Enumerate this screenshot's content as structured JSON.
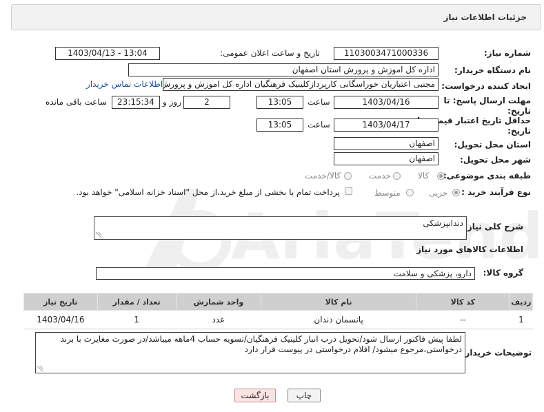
{
  "header": {
    "title": "جزئیات اطلاعات نیاز"
  },
  "form": {
    "need_number_label": "شماره نیاز:",
    "need_number": "1103003471000336",
    "announce_label": "تاریخ و ساعت اعلان عمومی:",
    "announce_value": "1403/04/13 - 13:04",
    "buyer_org_label": "نام دستگاه خریدار:",
    "buyer_org": "اداره کل اموزش و پرورش استان اصفهان",
    "creator_label": "ایجاد کننده درخواست:",
    "creator": "مجتبی اعتباریان خوراسگانی کارپرداز‌کلینیک فرهنگیان اداره کل اموزش و پرورش ا",
    "contact_link": "اطلاعات تماس خریدار",
    "deadline_label_1": "مهلت ارسال پاسخ: تا",
    "deadline_label_2": "تاریخ:",
    "deadline_date": "1403/04/16",
    "time_label": "ساعت",
    "deadline_time": "13:05",
    "days_value": "2",
    "days_label": "روز و",
    "remaining_time": "23:15:34",
    "remaining_label": "ساعت باقی مانده",
    "validity_label_1": "حداقل تاریخ اعتبار قیمت: تا",
    "validity_label_2": "تاریخ:",
    "validity_date": "1403/04/17",
    "validity_time": "13:05",
    "province_label": "استان محل تحویل:",
    "province": "اصفهان",
    "city_label": "شهر محل تحویل:",
    "city": "اصفهان",
    "category_label": "طبقه بندی موضوعی:",
    "category_options": [
      "کالا",
      "خدمت",
      "کالا/خدمت"
    ],
    "process_label": "نوع فرآیند خرید :",
    "process_options": [
      "جزیی",
      "متوسط"
    ],
    "payment_note": "پرداخت تمام یا بخشی از مبلغ خرید،از محل \"اسناد خزانه اسلامی\" خواهد بود."
  },
  "description": {
    "label": "شرح کلی نیاز:",
    "value": "دندانپزشکی"
  },
  "goods": {
    "section_title": "اطلاعات کالاهای مورد نیاز",
    "group_label": "گروه کالا:",
    "group_value": "دارو، پزشکی و سلامت"
  },
  "table": {
    "headers": [
      "ردیف",
      "کد کالا",
      "نام کالا",
      "واحد شمارش",
      "تعداد / مقدار",
      "تاریخ نیاز"
    ],
    "rows": [
      [
        "1",
        "--",
        "پانسمان دندان",
        "عدد",
        "1",
        "1403/04/16"
      ]
    ]
  },
  "buyer_notes": {
    "label": "توضیحات خریدار:",
    "value": "لطفا پیش فاکتور ارسال شود/تحویل درب انبار کلینیک فرهنگیان/تسویه حساب 4ماهه میباشد/در صورت مغایرت با برند درخواستی،مرجوع میشود/ اقلام درخواستی در پیوست قرار دارد"
  },
  "buttons": {
    "print": "چاپ",
    "back": "بازگشت"
  },
  "watermark": {
    "text": "AriaTender.net"
  }
}
